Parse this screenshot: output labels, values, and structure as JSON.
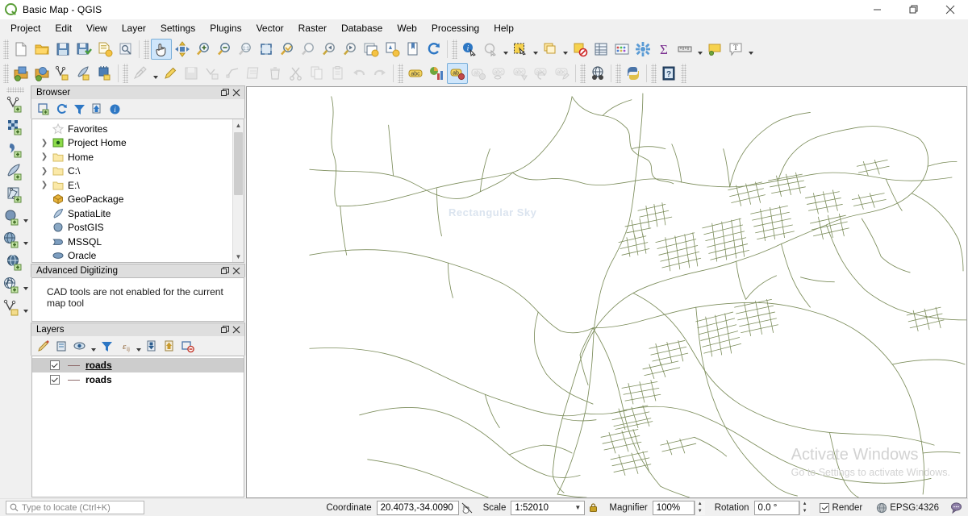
{
  "window": {
    "title": "Basic Map - QGIS",
    "app_icon": "qgis-logo-icon",
    "minimize_label": "Minimize",
    "maximize_label": "Restore",
    "close_label": "Close"
  },
  "menubar": {
    "items": [
      {
        "label": "Project"
      },
      {
        "label": "Edit"
      },
      {
        "label": "View"
      },
      {
        "label": "Layer"
      },
      {
        "label": "Settings"
      },
      {
        "label": "Plugins"
      },
      {
        "label": "Vector"
      },
      {
        "label": "Raster"
      },
      {
        "label": "Database"
      },
      {
        "label": "Web"
      },
      {
        "label": "Processing"
      },
      {
        "label": "Help"
      }
    ]
  },
  "toolbar_row1": {
    "groups": [
      {
        "name": "project-toolbar",
        "buttons": [
          {
            "icon": "new-project-icon",
            "tip": "New Project"
          },
          {
            "icon": "open-project-icon",
            "tip": "Open Project"
          },
          {
            "icon": "save-project-icon",
            "tip": "Save Project"
          },
          {
            "icon": "save-project-as-icon",
            "tip": "Save Project As"
          },
          {
            "icon": "new-print-layout-icon",
            "tip": "New Print Layout"
          },
          {
            "icon": "layout-manager-icon",
            "tip": "Show Layout Manager"
          }
        ]
      },
      {
        "name": "map-navigation-toolbar",
        "buttons": [
          {
            "icon": "pan-map-icon",
            "tip": "Pan Map",
            "active": true
          },
          {
            "icon": "pan-to-selection-icon",
            "tip": "Pan Map to Selection"
          },
          {
            "icon": "zoom-in-icon",
            "tip": "Zoom In"
          },
          {
            "icon": "zoom-out-icon",
            "tip": "Zoom Out"
          },
          {
            "icon": "zoom-native-icon",
            "tip": "Zoom to Native Resolution"
          },
          {
            "icon": "zoom-full-icon",
            "tip": "Zoom Full"
          },
          {
            "icon": "zoom-to-selection-icon",
            "tip": "Zoom to Selection"
          },
          {
            "icon": "zoom-to-layer-icon",
            "tip": "Zoom to Layer"
          },
          {
            "icon": "zoom-last-icon",
            "tip": "Zoom Last"
          },
          {
            "icon": "zoom-next-icon",
            "tip": "Zoom Next"
          },
          {
            "icon": "new-map-view-icon",
            "tip": "New Map View"
          },
          {
            "icon": "new-3d-map-view-icon",
            "tip": "New 3D Map View"
          },
          {
            "icon": "bookmarks-icon",
            "tip": "Show Bookmarks"
          },
          {
            "icon": "refresh-icon",
            "tip": "Refresh"
          }
        ]
      },
      {
        "name": "attributes-toolbar",
        "buttons": [
          {
            "icon": "identify-features-icon",
            "tip": "Identify Features"
          },
          {
            "icon": "run-feature-action-icon",
            "tip": "Run Feature Action",
            "dropdown": true,
            "dim": true
          },
          {
            "icon": "select-features-icon",
            "tip": "Select Features",
            "dropdown": true
          },
          {
            "icon": "select-by-value-icon",
            "tip": "Select Features by Value",
            "dropdown": true
          },
          {
            "icon": "deselect-features-icon",
            "tip": "Deselect Features from All Layers"
          },
          {
            "icon": "open-attribute-table-icon",
            "tip": "Open Attribute Table"
          },
          {
            "icon": "field-calculator-icon",
            "tip": "Open Field Calculator"
          },
          {
            "icon": "processing-toolbox-icon",
            "tip": "Processing Toolbox"
          },
          {
            "icon": "statistical-summary-icon",
            "tip": "Show Statistical Summary"
          },
          {
            "icon": "measure-line-icon",
            "tip": "Measure Line",
            "dropdown": true
          },
          {
            "icon": "map-tips-icon",
            "tip": "Show Map Tips"
          },
          {
            "icon": "text-annotation-icon",
            "tip": "Text Annotation",
            "dropdown": true
          }
        ]
      }
    ]
  },
  "toolbar_row2": {
    "groups": [
      {
        "name": "manage-layers-toolbar",
        "buttons": [
          {
            "icon": "data-source-manager-icon",
            "tip": "Open Data Source Manager"
          },
          {
            "icon": "add-vector-layer-icon",
            "tip": "Add Vector Layer"
          },
          {
            "icon": "new-shapefile-layer-icon",
            "tip": "New Shapefile Layer"
          },
          {
            "icon": "new-spatialite-layer-icon",
            "tip": "New SpatiaLite Layer"
          },
          {
            "icon": "new-memory-layer-icon",
            "tip": "New Temporary Scratch Layer"
          }
        ]
      },
      {
        "name": "digitizing-toolbar",
        "buttons": [
          {
            "icon": "current-edits-icon",
            "tip": "Current Edits",
            "dropdown": true,
            "dim": true
          },
          {
            "icon": "toggle-editing-icon",
            "tip": "Toggle Editing"
          },
          {
            "icon": "save-layer-edits-icon",
            "tip": "Save Layer Edits",
            "dim": true
          },
          {
            "icon": "add-feature-icon",
            "tip": "Add Feature",
            "dim": true
          },
          {
            "icon": "vertex-tool-icon",
            "tip": "Vertex Tool",
            "dim": true
          },
          {
            "icon": "modify-attributes-icon",
            "tip": "Modify Attributes of Selected Features",
            "dim": true
          },
          {
            "icon": "delete-selected-icon",
            "tip": "Delete Selected",
            "dim": true
          },
          {
            "icon": "cut-features-icon",
            "tip": "Cut Features",
            "dim": true
          },
          {
            "icon": "copy-features-icon",
            "tip": "Copy Features",
            "dim": true
          },
          {
            "icon": "paste-features-icon",
            "tip": "Paste Features",
            "dim": true
          },
          {
            "icon": "undo-icon",
            "tip": "Undo",
            "dim": true
          },
          {
            "icon": "redo-icon",
            "tip": "Redo",
            "dim": true
          }
        ]
      },
      {
        "name": "label-toolbar",
        "buttons": [
          {
            "icon": "layer-labeling-icon",
            "tip": "Layer Labeling Options"
          },
          {
            "icon": "layer-diagram-icon",
            "tip": "Layer Diagram Options"
          },
          {
            "icon": "highlight-pinned-labels-icon",
            "tip": "Highlight Pinned Labels",
            "active": true
          },
          {
            "icon": "pin-labels-icon",
            "tip": "Pin/Unpin Labels and Diagrams",
            "dim": true
          },
          {
            "icon": "show-hide-labels-icon",
            "tip": "Show/Hide Labels and Diagrams",
            "dim": true
          },
          {
            "icon": "move-label-icon",
            "tip": "Move Label or Diagram",
            "dim": true
          },
          {
            "icon": "rotate-label-icon",
            "tip": "Rotate Label",
            "dim": true
          },
          {
            "icon": "change-label-icon",
            "tip": "Change Label",
            "dim": true
          }
        ]
      },
      {
        "name": "web-toolbar",
        "buttons": [
          {
            "icon": "metasearch-icon",
            "tip": "MetaSearch"
          }
        ]
      },
      {
        "name": "plugins-toolbar",
        "buttons": [
          {
            "icon": "python-console-icon",
            "tip": "Python Console"
          }
        ]
      },
      {
        "name": "help-toolbar",
        "buttons": [
          {
            "icon": "help-contents-icon",
            "tip": "Help Contents"
          }
        ]
      }
    ]
  },
  "vertical_toolbar": {
    "name": "data-source-toolbar",
    "buttons": [
      {
        "icon": "add-vector-layer-icon",
        "tip": "Add Vector Layer"
      },
      {
        "icon": "add-raster-layer-icon",
        "tip": "Add Raster Layer"
      },
      {
        "icon": "add-delimited-text-layer-icon",
        "tip": "Add Delimited Text Layer"
      },
      {
        "icon": "add-spatialite-layer-icon",
        "tip": "Add SpatiaLite Layer"
      },
      {
        "icon": "add-mesh-layer-icon",
        "tip": "Add Mesh Layer"
      },
      {
        "icon": "add-postgis-layer-icon",
        "tip": "Add PostGIS Layer",
        "dropdown": true
      },
      {
        "icon": "add-wms-layer-icon",
        "tip": "Add WMS/WMTS Layer",
        "dropdown": true
      },
      {
        "icon": "add-wcs-layer-icon",
        "tip": "Add WCS Layer"
      },
      {
        "icon": "add-wfs-layer-icon",
        "tip": "Add WFS Layer",
        "dropdown": true
      },
      {
        "icon": "add-virtual-layer-icon",
        "tip": "Add/Edit Virtual Layer",
        "dropdown": true
      }
    ]
  },
  "browser_panel": {
    "title": "Browser",
    "float_label": "Float",
    "close_label": "Close",
    "toolbar": [
      {
        "icon": "add-selected-layers-icon",
        "tip": "Add Selected Layers"
      },
      {
        "icon": "refresh-icon",
        "tip": "Refresh"
      },
      {
        "icon": "filter-browser-icon",
        "tip": "Filter Browser"
      },
      {
        "icon": "collapse-all-icon",
        "tip": "Collapse All"
      },
      {
        "icon": "enable-properties-widget-icon",
        "tip": "Enable/Disable Properties Widget"
      }
    ],
    "tree": [
      {
        "label": "Favorites",
        "icon": "star-icon",
        "expandable": false
      },
      {
        "label": "Project Home",
        "icon": "project-home-icon",
        "expandable": true
      },
      {
        "label": "Home",
        "icon": "folder-icon",
        "expandable": true
      },
      {
        "label": "C:\\",
        "icon": "folder-icon",
        "expandable": true
      },
      {
        "label": "E:\\",
        "icon": "folder-icon",
        "expandable": true
      },
      {
        "label": "GeoPackage",
        "icon": "geopackage-icon",
        "expandable": false
      },
      {
        "label": "SpatiaLite",
        "icon": "spatialite-icon",
        "expandable": false
      },
      {
        "label": "PostGIS",
        "icon": "postgis-icon",
        "expandable": false
      },
      {
        "label": "MSSQL",
        "icon": "mssql-icon",
        "expandable": false
      },
      {
        "label": "Oracle",
        "icon": "oracle-icon",
        "expandable": false
      }
    ]
  },
  "advanced_digitizing_panel": {
    "title": "Advanced Digitizing",
    "message": "CAD tools are not enabled for the current map tool"
  },
  "layers_panel": {
    "title": "Layers",
    "toolbar": [
      {
        "icon": "open-layer-styling-icon",
        "tip": "Open the Layer Styling panel"
      },
      {
        "icon": "add-group-icon",
        "tip": "Add Group"
      },
      {
        "icon": "manage-layer-visibility-icon",
        "tip": "Manage Map Themes",
        "dropdown": true
      },
      {
        "icon": "filter-legend-icon",
        "tip": "Filter Legend"
      },
      {
        "icon": "expression-filter-icon",
        "tip": "Filter Legend by Expression",
        "dropdown": true
      },
      {
        "icon": "expand-all-icon",
        "tip": "Expand All"
      },
      {
        "icon": "collapse-all-icon",
        "tip": "Collapse All"
      },
      {
        "icon": "remove-layer-icon",
        "tip": "Remove Layer/Group"
      }
    ],
    "layers": [
      {
        "name": "roads",
        "checked": true,
        "selected": true,
        "symbol_color": "#8d6a6a"
      },
      {
        "name": "roads",
        "checked": true,
        "selected": false,
        "symbol_color": "#8d6a6a"
      }
    ]
  },
  "map_canvas": {
    "background_color": "#ffffff",
    "road_color": "#7b8c5a",
    "city_label": "Rectangular Sky",
    "watermark_line1": "Activate Windows",
    "watermark_line2": "Go to Settings to activate Windows."
  },
  "statusbar": {
    "locator_placeholder": "Type to locate (Ctrl+K)",
    "locator_icon": "search-icon",
    "coordinate_label": "Coordinate",
    "coordinate_value": "20.4073,-34.0090",
    "coordinate_toggle_icon": "toggle-extents-icon",
    "scale_label": "Scale",
    "scale_value": "1:52010",
    "scale_lock_icon": "lock-icon",
    "magnifier_label": "Magnifier",
    "magnifier_value": "100%",
    "rotation_label": "Rotation",
    "rotation_value": "0.0 °",
    "render_label": "Render",
    "render_checked": true,
    "crs_label": "EPSG:4326",
    "crs_icon": "globe-icon",
    "messages_icon": "messages-icon"
  }
}
